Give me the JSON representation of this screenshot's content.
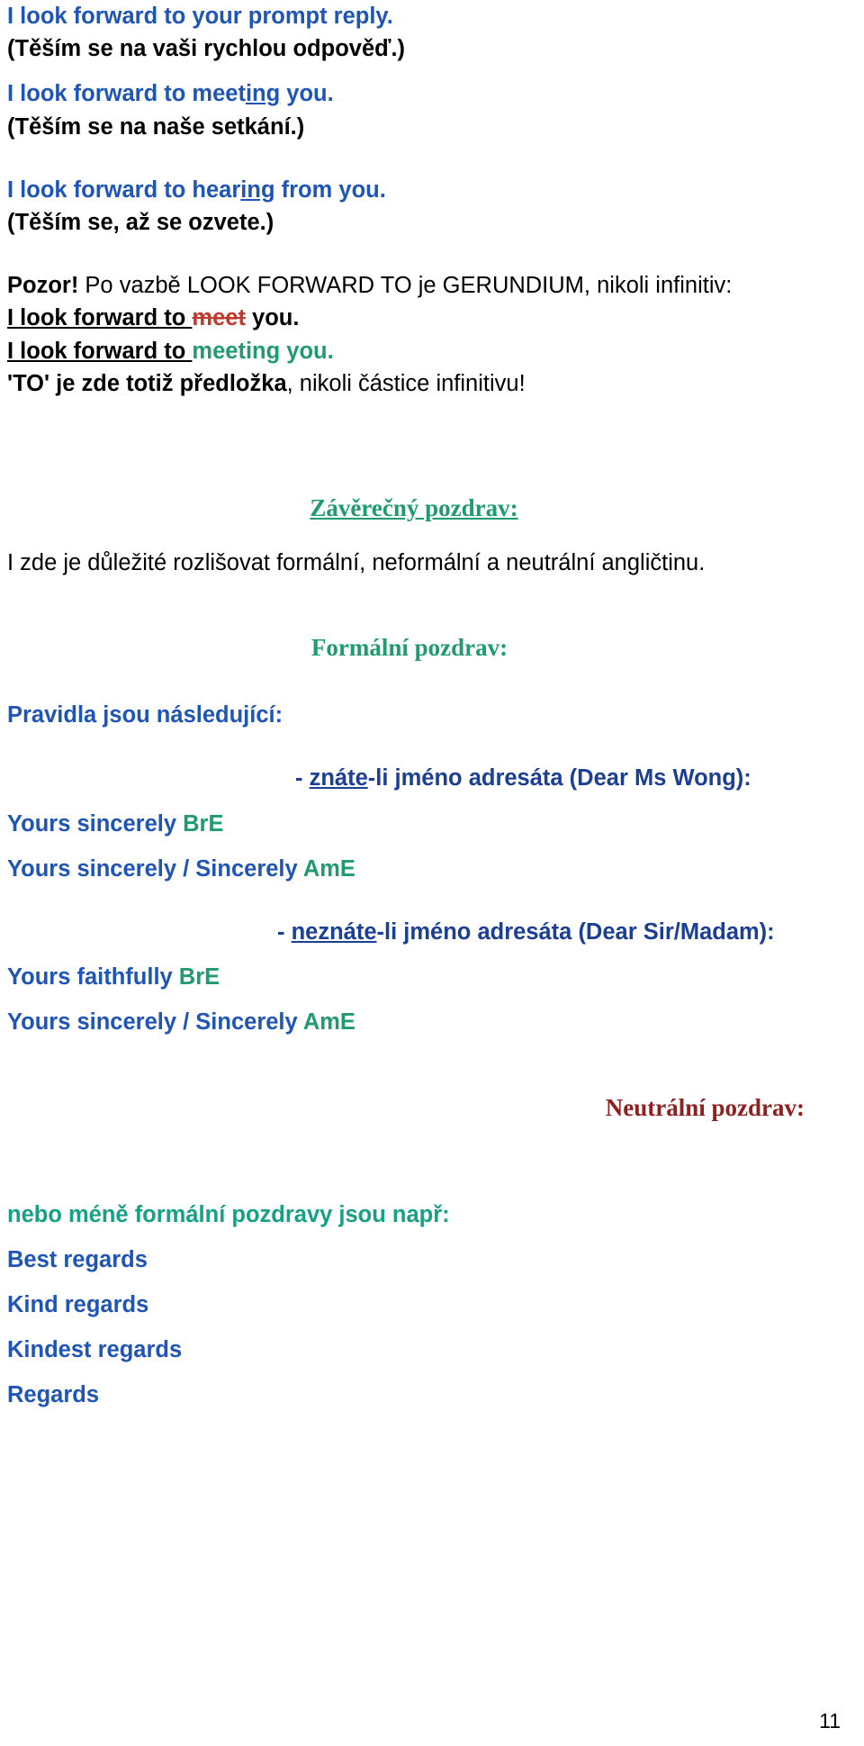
{
  "document": {
    "page_number": "11",
    "examples": [
      {
        "en": "I look forward to your prompt reply.",
        "cz": "(Těším se na vaši rychlou odpověď.)"
      },
      {
        "en_pre": "I look forward to meet",
        "en_underline": "ing",
        "en_post": " you.",
        "cz": "(Těším se na naše setkání.)"
      },
      {
        "en_pre": "I look forward to hear",
        "en_underline": "ing",
        "en_post": " from you.",
        "cz": "(Těším se, až se ozvete.)"
      }
    ],
    "pozor": {
      "label": "Pozor!",
      "rest": " Po vazbě LOOK FORWARD TO je GERUNDIUM, nikoli infinitiv:",
      "wrong_prefix": "I look forward to ",
      "wrong_word": "meet",
      "wrong_suffix": " you.",
      "right_prefix": "I look forward to ",
      "right_word": "meeting you.",
      "note_prefix": "'TO' je zde totiž ",
      "note_bold": "předložka",
      "note_suffix": ", nikoli částice infinitivu!"
    },
    "closing": {
      "heading": "Závěrečný pozdrav:",
      "intro": "I zde je důležité rozlišovat formální, neformální a neutrální angličtinu.",
      "formal_heading": "Formální pozdrav:",
      "rules_label": "Pravidla jsou následující:",
      "known_prefix": "- ",
      "known_underline": "znáte",
      "known_suffix": "-li jméno adresáta (Dear Ms Wong):",
      "known_options": [
        {
          "text": "Yours sincerely ",
          "variant": "BrE"
        },
        {
          "text": "Yours sincerely / Sincerely ",
          "variant": "AmE"
        }
      ],
      "unknown_prefix": "- ",
      "unknown_underline": "neznáte",
      "unknown_suffix": "-li jméno adresáta (Dear Sir/Madam):",
      "unknown_options": [
        {
          "text": "Yours faithfully ",
          "variant": "BrE"
        },
        {
          "text": "Yours sincerely / Sincerely ",
          "variant": "AmE"
        }
      ],
      "neutral_heading": "Neutrální pozdrav:",
      "neutral_intro": "nebo méně formální pozdravy jsou např:",
      "neutral_items": [
        "Best regards",
        "Kind regards",
        "Kindest regards",
        "Regards"
      ]
    }
  }
}
